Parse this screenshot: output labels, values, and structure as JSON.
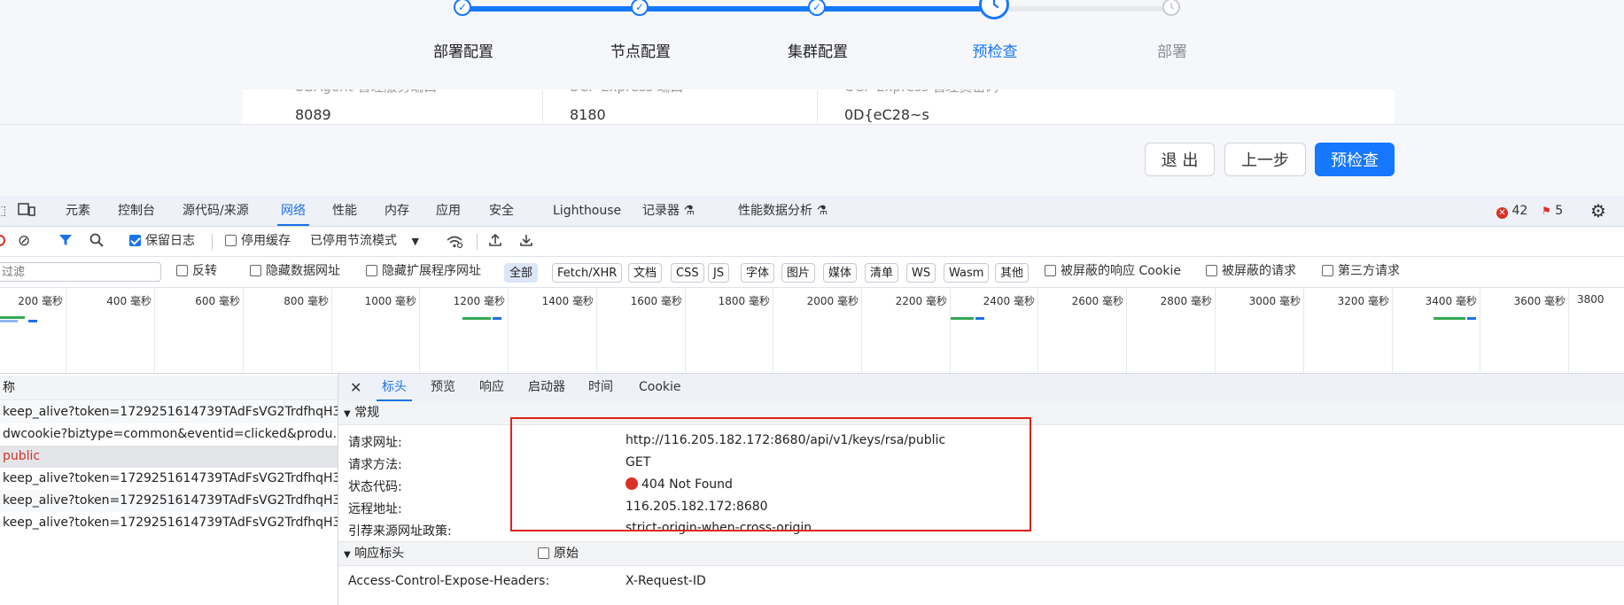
{
  "wizard": {
    "steps": [
      {
        "label": "部署配置",
        "state": "done"
      },
      {
        "label": "节点配置",
        "state": "done"
      },
      {
        "label": "集群配置",
        "state": "done"
      },
      {
        "label": "预检查",
        "state": "current"
      },
      {
        "label": "部署",
        "state": "todo"
      }
    ],
    "card": {
      "columns": [
        {
          "label": "OBAgent 管理服务端口",
          "value": "8089"
        },
        {
          "label": "OCP Express 端口",
          "value": "8180"
        },
        {
          "label": "OCP Express 管理员密码",
          "value": "0D{eC28~s"
        }
      ]
    },
    "buttons": {
      "exit": "退 出",
      "prev": "上一步",
      "precheck": "预检查"
    }
  },
  "devtools": {
    "tabs": [
      "元素",
      "控制台",
      "源代码/来源",
      "网络",
      "性能",
      "内存",
      "应用",
      "安全",
      "Lighthouse",
      "记录器",
      "性能数据分析"
    ],
    "active_tab": "网络",
    "error_count": "42",
    "issue_count": "5",
    "toolbar": {
      "preserve_log": "保留日志",
      "disable_cache": "停用缓存",
      "throttle": "已停用节流模式"
    },
    "filter": {
      "placeholder": "过滤",
      "invert": "反转",
      "hide_data_urls": "隐藏数据网址",
      "hide_extension_urls": "隐藏扩展程序网址",
      "types": [
        "全部",
        "Fetch/XHR",
        "文档",
        "CSS",
        "JS",
        "字体",
        "图片",
        "媒体",
        "清单",
        "WS",
        "Wasm",
        "其他"
      ],
      "blocked_cookies": "被屏蔽的响应 Cookie",
      "blocked_requests": "被屏蔽的请求",
      "third_party": "第三方请求"
    },
    "timeline_ticks": [
      "200 毫秒",
      "400 毫秒",
      "600 毫秒",
      "800 毫秒",
      "1000 毫秒",
      "1200 毫秒",
      "1400 毫秒",
      "1600 毫秒",
      "1800 毫秒",
      "2000 毫秒",
      "2200 毫秒",
      "2400 毫秒",
      "2600 毫秒",
      "2800 毫秒",
      "3000 毫秒",
      "3200 毫秒",
      "3400 毫秒",
      "3600 毫秒",
      "3800"
    ],
    "request_list": {
      "header": "称",
      "rows": [
        "keep_alive?token=1729251614739TAdFsVG2TrdfhqH3...",
        "dwcookie?biztype=common&eventid=clicked&produ...",
        "public",
        "keep_alive?token=1729251614739TAdFsVG2TrdfhqH3...",
        "keep_alive?token=1729251614739TAdFsVG2TrdfhqH3...",
        "keep_alive?token=1729251614739TAdFsVG2TrdfhqH3..."
      ]
    },
    "detail": {
      "tabs": [
        "标头",
        "预览",
        "响应",
        "启动器",
        "时间",
        "Cookie"
      ],
      "general_title": "常规",
      "general": [
        {
          "key": "请求网址:",
          "value": "http://116.205.182.172:8680/api/v1/keys/rsa/public"
        },
        {
          "key": "请求方法:",
          "value": "GET"
        },
        {
          "key": "状态代码:",
          "value": "404 Not Found"
        },
        {
          "key": "远程地址:",
          "value": "116.205.182.172:8680"
        },
        {
          "key": "引荐来源网址政策:",
          "value": "strict-origin-when-cross-origin"
        }
      ],
      "response_headers_title": "响应标头",
      "raw_label": "原始",
      "response_headers": [
        {
          "key": "Access-Control-Expose-Headers:",
          "value": "X-Request-ID"
        }
      ]
    }
  },
  "colors": {
    "accent": "#1677ff",
    "devtools_accent": "#1a73e8",
    "error_red": "#e0211a",
    "status_red": "#d93025"
  }
}
